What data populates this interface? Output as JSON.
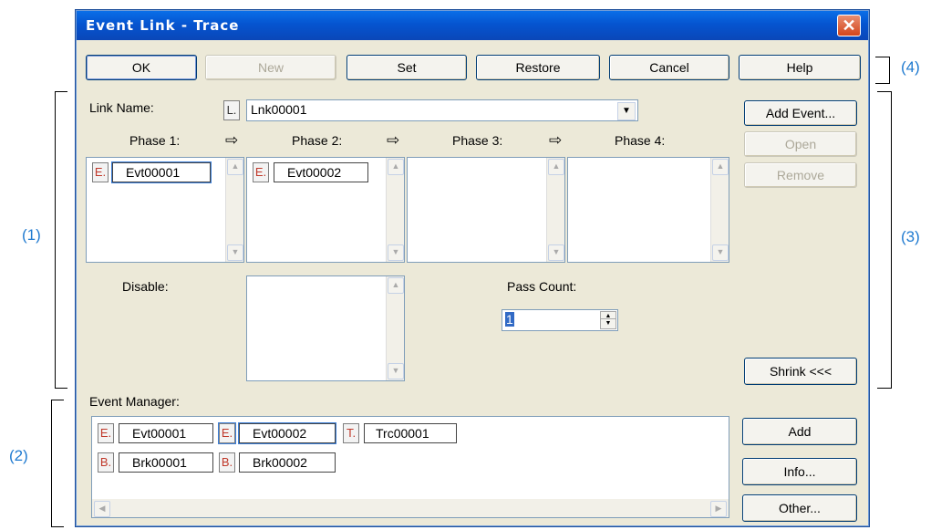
{
  "window": {
    "title": "Event Link - Trace",
    "close_symbol": "✕"
  },
  "toolbar": {
    "ok": "OK",
    "new": "New",
    "set": "Set",
    "restore": "Restore",
    "cancel": "Cancel",
    "help": "Help"
  },
  "link": {
    "label": "Link Name:",
    "icon_letter": "L.",
    "value": "Lnk00001"
  },
  "phases": [
    {
      "label": "Phase 1:",
      "events": [
        "Evt00001"
      ]
    },
    {
      "label": "Phase 2:",
      "events": [
        "Evt00002"
      ]
    },
    {
      "label": "Phase 3:",
      "events": []
    },
    {
      "label": "Phase 4:",
      "events": []
    }
  ],
  "disable": {
    "label": "Disable:"
  },
  "pass_count": {
    "label": "Pass Count:",
    "value": "1"
  },
  "side_buttons": {
    "add_event": "Add Event...",
    "open": "Open",
    "remove": "Remove",
    "shrink": "Shrink <<<"
  },
  "event_manager": {
    "label": "Event Manager:",
    "items_row1": [
      {
        "type": "E.",
        "name": "Evt00001"
      },
      {
        "type": "E.",
        "name": "Evt00002"
      },
      {
        "type": "T.",
        "name": "Trc00001"
      }
    ],
    "items_row2": [
      {
        "type": "B.",
        "name": "Brk00001"
      },
      {
        "type": "B.",
        "name": "Brk00002"
      }
    ],
    "add": "Add",
    "info": "Info...",
    "other": "Other..."
  },
  "annotations": {
    "a1": "(1)",
    "a2": "(2)",
    "a3": "(3)",
    "a4": "(4)"
  },
  "colors": {
    "title_bar": "#0554d0",
    "dialog_bg": "#ECE9D8",
    "annotation": "#1f7ad0",
    "event_icon_text": "#c0392b"
  }
}
